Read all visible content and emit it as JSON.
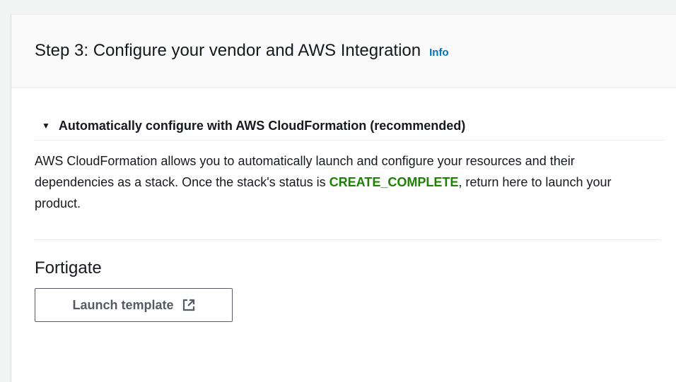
{
  "header": {
    "title": "Step 3: Configure your vendor and AWS Integration",
    "info_label": "Info"
  },
  "expandable": {
    "label": "Automatically configure with AWS CloudFormation (recommended)",
    "expanded": true
  },
  "description": {
    "before": "AWS CloudFormation allows you to automatically launch and configure your resources and their dependencies as a stack. Once the stack's status is ",
    "status": "CREATE_COMPLETE",
    "after": ", return here to launch your product."
  },
  "vendor": {
    "name": "Fortigate",
    "launch_label": "Launch template",
    "launch_icon": "external-link-icon"
  },
  "colors": {
    "link": "#0073bb",
    "status_success": "#1d8102",
    "button_border": "#545b64"
  }
}
